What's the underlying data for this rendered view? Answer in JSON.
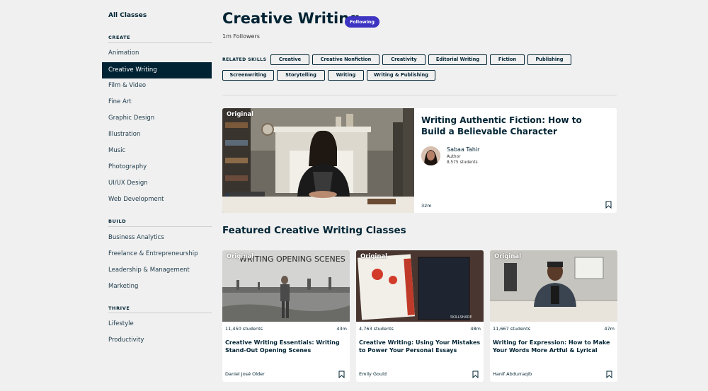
{
  "sidebar": {
    "all_classes": "All Classes",
    "sections": [
      {
        "title": "CREATE",
        "items": [
          "Animation",
          "Creative Writing",
          "Film & Video",
          "Fine Art",
          "Graphic Design",
          "Illustration",
          "Music",
          "Photography",
          "UI/UX Design",
          "Web Development"
        ]
      },
      {
        "title": "BUILD",
        "items": [
          "Business Analytics",
          "Freelance & Entrepreneurship",
          "Leadership & Management",
          "Marketing"
        ]
      },
      {
        "title": "THRIVE",
        "items": [
          "Lifestyle",
          "Productivity"
        ]
      }
    ],
    "active_item": "Creative Writing"
  },
  "header": {
    "title": "Creative Writing",
    "follow_label": "Following",
    "followers": "1m Followers"
  },
  "related": {
    "label": "RELATED SKILLS",
    "chips": [
      "Creative",
      "Creative Nonfiction",
      "Creativity",
      "Editorial Writing",
      "Fiction",
      "Publishing",
      "Screenwriting",
      "Storytelling",
      "Writing",
      "Writing & Publishing"
    ]
  },
  "hero": {
    "tag": "Original",
    "title": "Writing Authentic Fiction: How to Build a Believable Character",
    "teacher": "Sabaa Tahir",
    "role": "Author",
    "students": "8,575 students",
    "duration": "32m"
  },
  "featured": {
    "title": "Featured Creative Writing Classes",
    "cards": [
      {
        "tag": "Original",
        "students": "11,450 students",
        "duration": "43m",
        "title": "Creative Writing Essentials: Writing Stand-Out Opening Scenes",
        "teacher": "Daniel José Older",
        "thumb_text": "WRITING OPENING SCENES"
      },
      {
        "tag": "Original",
        "students": "4,763 students",
        "duration": "48m",
        "title": "Creative Writing: Using Your Mistakes to Power Your Personal Essays",
        "teacher": "Emily Gould",
        "thumb_text": "SKILLSHARE"
      },
      {
        "tag": "Original",
        "students": "11,667 students",
        "duration": "47m",
        "title": "Writing for Expression: How to Make Your Words More Artful & Lyrical",
        "teacher": "Hanif Abdurraqib"
      }
    ]
  },
  "colors": {
    "navy": "#002333",
    "accent": "#3d34c2",
    "background": "#f0f0f0"
  }
}
